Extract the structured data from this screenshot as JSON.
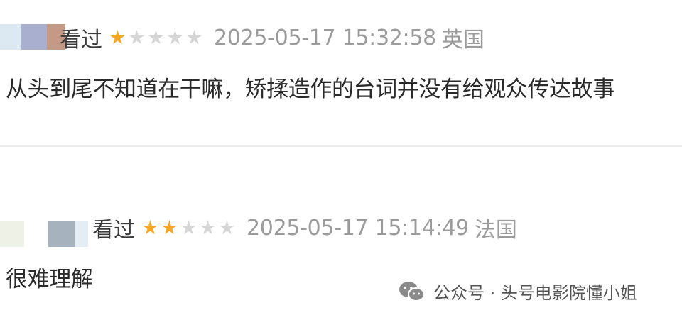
{
  "reviews": [
    {
      "status": "看过",
      "rating": 1,
      "max_rating": 5,
      "time": "2025-05-17 15:32:58",
      "location": "英国",
      "content": "从头到尾不知道在干嘛，矫揉造作的台词并没有给观众传达故事"
    },
    {
      "status": "看过",
      "rating": 2,
      "max_rating": 5,
      "time": "2025-05-17 15:14:49",
      "location": "法国",
      "content": "很难理解"
    }
  ],
  "watermark": {
    "text": "公众号 · 头号电影院懂小姐",
    "icon": "wechat-icon"
  },
  "colors": {
    "star_filled": "#f6a623",
    "star_empty": "#d6d6d6",
    "meta_gray": "#9b9b9b"
  }
}
